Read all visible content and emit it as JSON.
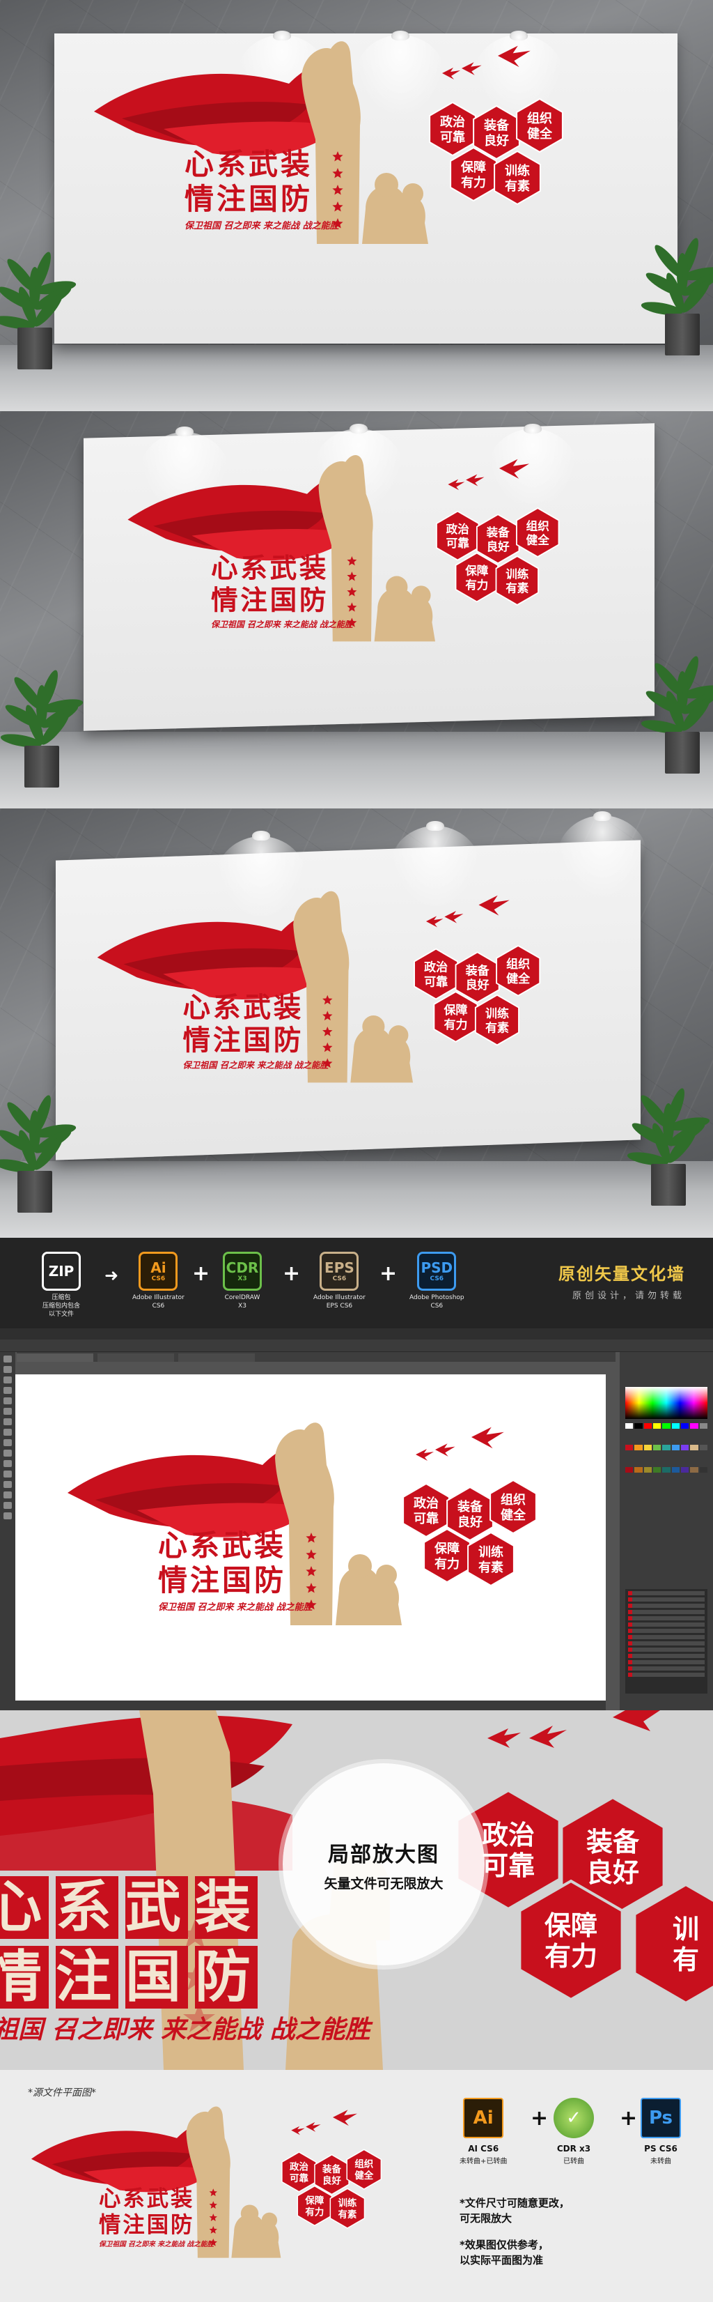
{
  "artwork": {
    "title_line1": "心系武装",
    "title_line2": "情注国防",
    "slogan": "保卫祖国 召之即来 来之能战 战之能胜",
    "hexagons": [
      "政治\n可靠",
      "装备\n良好",
      "组织\n健全",
      "保障\n有力",
      "训练\n有素"
    ],
    "colors": {
      "red": "#c8101d",
      "dark_red": "#a50c17",
      "tan": "#d9b98a"
    }
  },
  "formats": {
    "zip": {
      "label": "ZIP",
      "caption": "压缩包\n压缩包内包含\n以下文件"
    },
    "ai": {
      "label": "Ai",
      "version": "CS6",
      "caption": "Adobe Illustrator\nCS6"
    },
    "cdr": {
      "label": "CDR",
      "version": "X3",
      "sub": "已转曲",
      "caption": "CorelDRAW\nX3"
    },
    "eps": {
      "label": "EPS",
      "version": "CS6",
      "caption": "Adobe Illustrator\nEPS CS6"
    },
    "psd": {
      "label": "PSD",
      "version": "CS6",
      "caption": "Adobe Photoshop\nCS6"
    },
    "brand_title": "原创矢量文化墙",
    "brand_sub": "原创设计，请勿转载"
  },
  "zoom": {
    "title": "局部放大图",
    "subtitle": "矢量文件可无限放大",
    "title_text": "心系武装",
    "title_text2": "情注国防",
    "slogan": "祖国 召之即来 来之能战 战之能胜",
    "hexes": [
      "政治\n可靠",
      "装备\n良好",
      "保障\n有力",
      "训\n有"
    ]
  },
  "bottom": {
    "source_label": "*源文件平面图*",
    "ai_label": "AI CS6",
    "ai_sub": "未转曲+已转曲",
    "cdr_label": "CDR x3",
    "cdr_sub": "已转曲",
    "ps_label": "PS CS6",
    "ps_sub": "未转曲",
    "note1": "*文件尺寸可随意更改，\n  可无限放大",
    "note2": "*效果图仅供参考，\n  以实际平面图为准"
  }
}
